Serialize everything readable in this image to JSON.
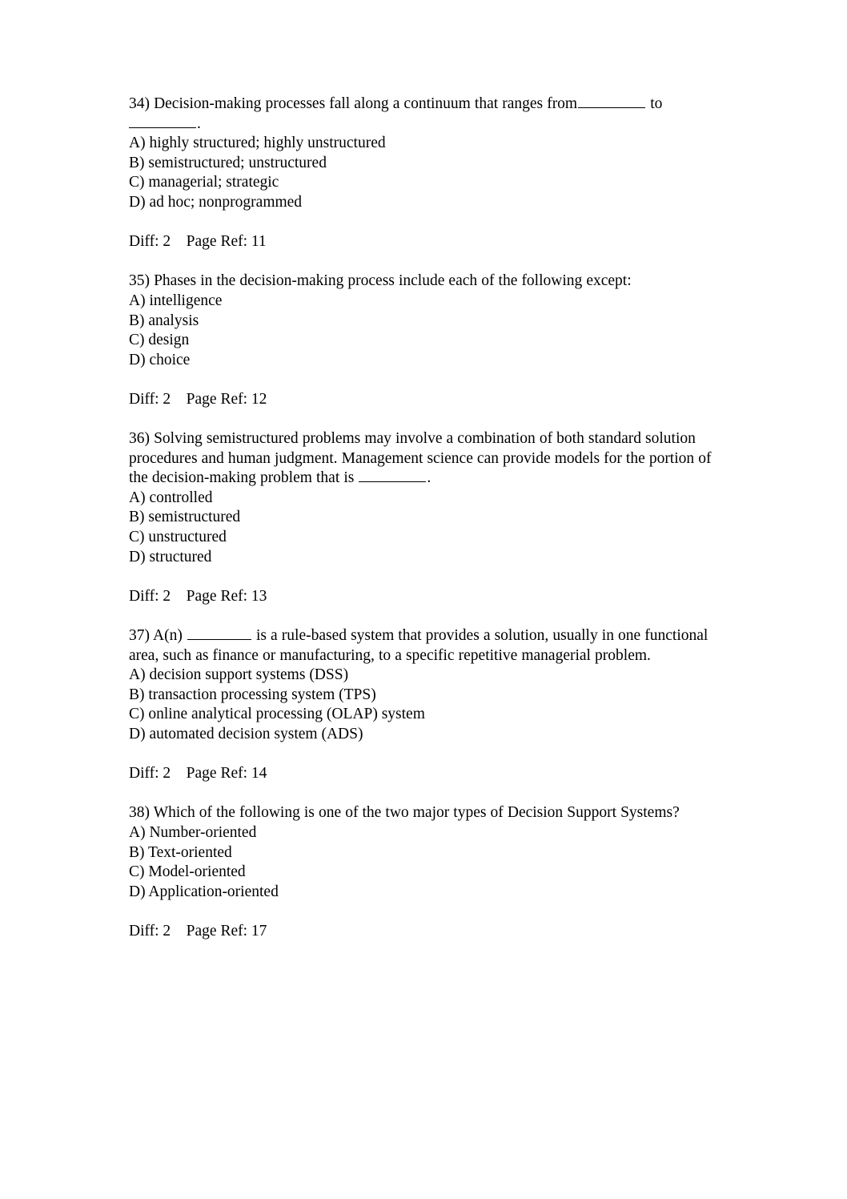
{
  "document": {
    "type": "multiple-choice-exam-page",
    "background_color": "#ffffff",
    "text_color": "#000000",
    "meta_labels": {
      "diff_prefix": "Diff:",
      "page_ref_prefix": "Page Ref:"
    }
  },
  "questions": [
    {
      "number": "34)",
      "stem_part_1": "34) Decision-making processes fall along a continuum that ranges from",
      "stem_part_2": "to",
      "stem_part_3": ".",
      "options": [
        "A) highly structured; highly unstructured",
        "B) semistructured; unstructured",
        "C) managerial; strategic",
        "D) ad hoc; nonprogrammed"
      ],
      "diff": "Diff: 2",
      "page_ref": "Page Ref: 11",
      "meta": "Diff: 2    Page Ref: 11"
    },
    {
      "number": "35)",
      "stem_part_1": "35) Phases in the decision-making process include each of the following except:",
      "options": [
        "A) intelligence",
        "B) analysis",
        "C) design",
        "D) choice"
      ],
      "diff": "Diff: 2",
      "page_ref": "Page Ref: 12",
      "meta": "Diff: 2    Page Ref: 12"
    },
    {
      "number": "36)",
      "stem_part_1": "36) Solving semistructured problems may involve a combination of both standard solution procedures and human judgment. Management science can provide models for the portion of the decision-making problem that is",
      "stem_part_2": ".",
      "options": [
        "A) controlled",
        "B) semistructured",
        "C) unstructured",
        "D) structured"
      ],
      "diff": "Diff: 2",
      "page_ref": "Page Ref: 13",
      "meta": "Diff: 2    Page Ref: 13"
    },
    {
      "number": "37)",
      "stem_part_1": "37) A(n)",
      "stem_part_2": "is a rule-based system that provides a solution, usually in one functional area, such as finance or manufacturing, to a specific repetitive managerial problem.",
      "options": [
        "A) decision support systems (DSS)",
        "B) transaction processing system (TPS)",
        "C) online analytical processing (OLAP) system",
        "D) automated decision system (ADS)"
      ],
      "diff": "Diff: 2",
      "page_ref": "Page Ref: 14",
      "meta": "Diff: 2    Page Ref: 14"
    },
    {
      "number": "38)",
      "stem_part_1": "38) Which of the following is one of the two major types of Decision Support Systems?",
      "options": [
        "A) Number-oriented",
        "B) Text-oriented",
        "C) Model-oriented",
        "D) Application-oriented"
      ],
      "diff": "Diff: 2",
      "page_ref": "Page Ref: 17",
      "meta": "Diff: 2    Page Ref: 17"
    }
  ]
}
